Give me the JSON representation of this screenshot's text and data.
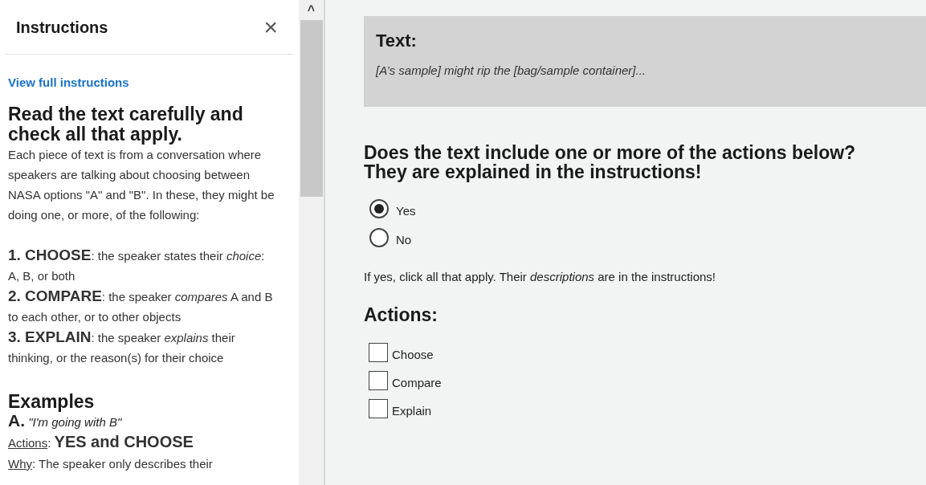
{
  "panel": {
    "title": "Instructions",
    "close": "×",
    "link": "View full instructions",
    "heading": "Read the text carefully and check all that apply.",
    "intro": "Each piece of text is from a conversation where speakers are talking about choosing between NASA options \"A\" and \"B\". In these, they might be doing one, or more, of the following:",
    "definitions": [
      "**1. CHOOSE**: the speaker states their *choice*: A, B, or both",
      "**2. COMPARE**: the speaker *compares* A and B to each other, or to other objects",
      "**3. EXPLAIN**: the speaker *explains* their thinking, or the reason(s) for their choice"
    ],
    "examples_heading": "Examples",
    "example": {
      "title": "**A.** *\"I'm going with B\"*",
      "lines": [
        {
          "label": "Actions",
          "text": ": **YES and CHOOSE**"
        },
        {
          "label": "Why",
          "text": ": The speaker only describes their"
        }
      ]
    }
  },
  "scroll_arrow": "^",
  "text_box": {
    "title": "Text:",
    "content": "[A’s sample] might rip the [bag/sample container]..."
  },
  "question": "Does the text include one or more of the actions below? They are explained in the instructions!",
  "answers": [
    {
      "label": "Yes",
      "selected": true
    },
    {
      "label": "No",
      "selected": false
    }
  ],
  "hint": "If yes, click all that apply. Their *descriptions* are in the instructions!",
  "actions_heading": "Actions:",
  "actions": [
    {
      "label": "Choose",
      "checked": false
    },
    {
      "label": "Compare",
      "checked": false
    },
    {
      "label": "Explain",
      "checked": false
    }
  ]
}
